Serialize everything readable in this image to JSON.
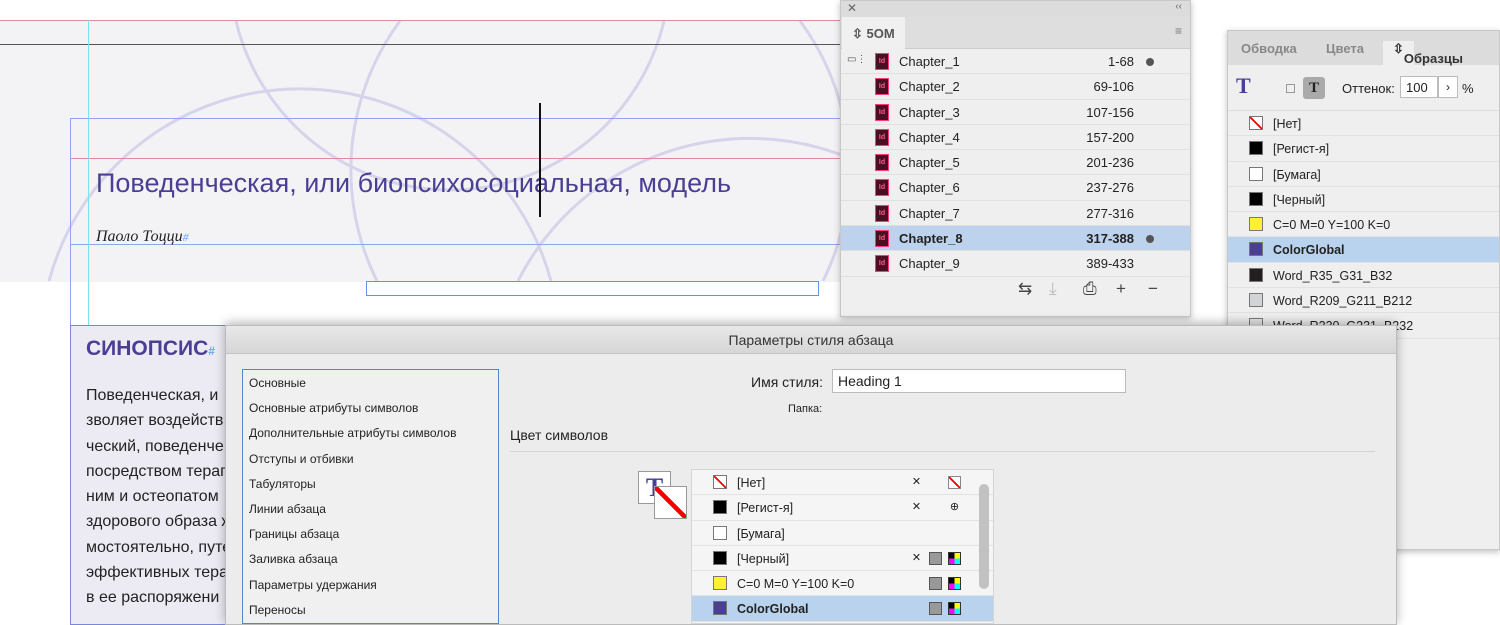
{
  "document": {
    "title": "Поведенческая, или биопсихосоциальная, модель",
    "author": "Паоло Тоцци",
    "section_heading": "СИНОПСИС",
    "body_lines": [
      "Поведенческая, и",
      "зволяет воздейств",
      "ческий, поведенче",
      "посредством терап",
      "ним и остеопатом",
      "здорового образа ж",
      "мостоятельно, путе",
      "эффективных терап",
      "в ее распоряжени"
    ]
  },
  "book_panel": {
    "tab_label": "5OM",
    "chapters": [
      {
        "name": "Chapter_1",
        "pages": "1-68",
        "dot": true
      },
      {
        "name": "Chapter_2",
        "pages": "69-106"
      },
      {
        "name": "Chapter_3",
        "pages": "107-156"
      },
      {
        "name": "Chapter_4",
        "pages": "157-200"
      },
      {
        "name": "Chapter_5",
        "pages": "201-236"
      },
      {
        "name": "Chapter_6",
        "pages": "237-276"
      },
      {
        "name": "Chapter_7",
        "pages": "277-316"
      },
      {
        "name": "Chapter_8",
        "pages": "317-388",
        "dot": true,
        "selected": true
      },
      {
        "name": "Chapter_9",
        "pages": "389-433"
      }
    ]
  },
  "swatches_panel": {
    "tabs": [
      "Обводка",
      "Цвета",
      "Образцы"
    ],
    "tint_label": "Оттенок:",
    "tint_value": "100",
    "percent": "%",
    "swatches": [
      {
        "name": "[Нет]",
        "color": "none"
      },
      {
        "name": "[Регист-я]",
        "color": "#000000"
      },
      {
        "name": "[Бумага]",
        "color": "#ffffff"
      },
      {
        "name": "[Черный]",
        "color": "#000000"
      },
      {
        "name": "C=0 M=0 Y=100 K=0",
        "color": "#fff033"
      },
      {
        "name": "ColorGlobal",
        "color": "#4b3f94",
        "selected": true
      },
      {
        "name": "Word_R35_G31_B32",
        "color": "#231f20"
      },
      {
        "name": "Word_R209_G211_B212",
        "color": "#d1d3d4"
      },
      {
        "name": "Word_R230_G231_B232",
        "color": "#e6e7e8"
      }
    ]
  },
  "dialog": {
    "title": "Параметры стиля абзаца",
    "categories": [
      "Основные",
      "Основные атрибуты символов",
      "Дополнительные атрибуты символов",
      "Отступы и отбивки",
      "Табуляторы",
      "Линии абзаца",
      "Границы абзаца",
      "Заливка абзаца",
      "Параметры удержания",
      "Переносы"
    ],
    "style_name_label": "Имя стиля:",
    "style_name_value": "Heading 1",
    "folder_label": "Папка:",
    "section_title": "Цвет символов",
    "swatches": [
      {
        "name": "[Нет]",
        "color": "none"
      },
      {
        "name": "[Регист-я]",
        "color": "#000000"
      },
      {
        "name": "[Бумага]",
        "color": "#ffffff"
      },
      {
        "name": "[Черный]",
        "color": "#000000"
      },
      {
        "name": "C=0 M=0 Y=100 K=0",
        "color": "#fff033"
      },
      {
        "name": "ColorGlobal",
        "color": "#4b3f94",
        "selected": true
      }
    ]
  }
}
